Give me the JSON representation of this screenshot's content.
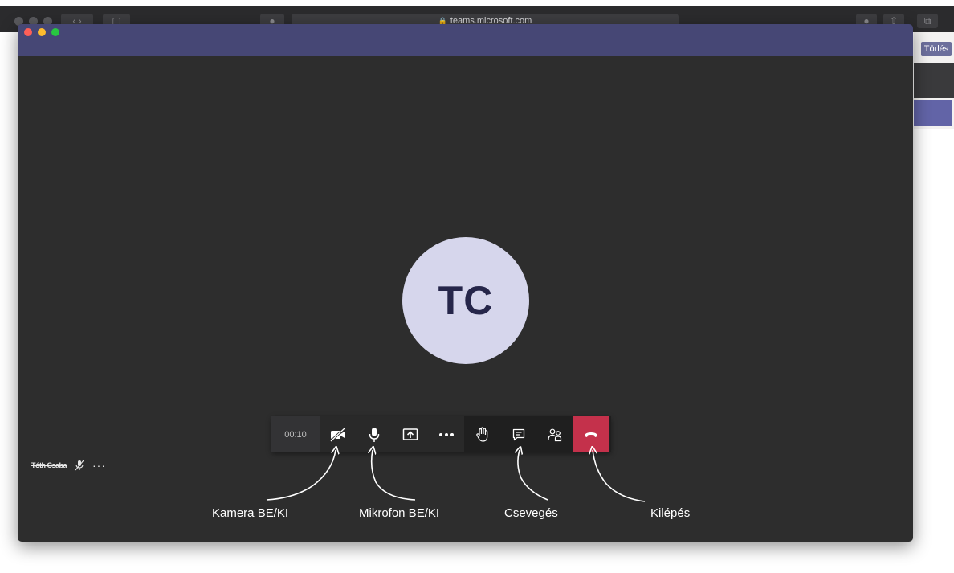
{
  "browser": {
    "url": "teams.microsoft.com",
    "bg_button": "Törlés"
  },
  "avatar": {
    "initials": "TC"
  },
  "call_toolbar": {
    "timer": "00:10"
  },
  "participant": {
    "name": "Tóth Csaba",
    "more": "···"
  },
  "annotations": {
    "camera": "Kamera BE/KI",
    "mic": "Mikrofon BE/KI",
    "chat": "Csevegés",
    "leave": "Kilépés"
  },
  "colors": {
    "titlebar": "#464775",
    "stage": "#2d2d2d",
    "hangup": "#c4314b",
    "avatar_bg": "#d6d6ec"
  },
  "icons": [
    "camera-off-icon",
    "microphone-icon",
    "share-screen-icon",
    "more-icon",
    "raise-hand-icon",
    "chat-icon",
    "participants-icon",
    "hang-up-icon",
    "mic-muted-icon"
  ]
}
